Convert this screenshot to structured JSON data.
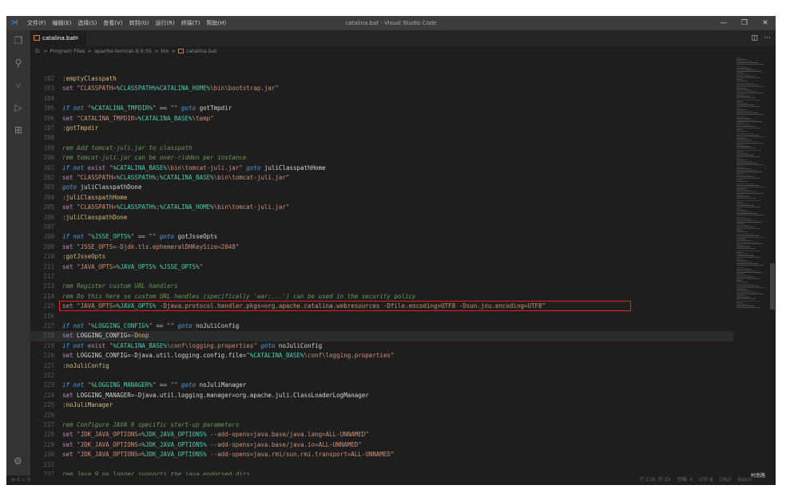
{
  "window": {
    "title": "catalina.bat - Visual Studio Code",
    "menu": [
      "文件(F)",
      "编辑(E)",
      "选择(S)",
      "查看(V)",
      "转到(G)",
      "运行(R)",
      "终端(T)",
      "帮助(H)"
    ],
    "controls": [
      "—",
      "❐",
      "✕"
    ]
  },
  "tab": {
    "label": "catalina.bat",
    "close": "✕"
  },
  "tab_actions": [
    "◫",
    "···"
  ],
  "breadcrumb": [
    "D:",
    ">",
    "Program Files",
    ">",
    "apache-tomcat-9.0.55",
    ">",
    "bin",
    ">",
    "catalina.bat"
  ],
  "editor": {
    "lines": [
      {
        "n": "192",
        "html": "<span class=\"lbl2\">:emptyClasspath</span>"
      },
      {
        "n": "193",
        "html": "<span class=\"cmd\">set</span> <span class=\"str\">\"CLASSPATH=<span class=\"var\">%CLASSPATH%</span><span class=\"var\">%CATALINA_HOME%</span>\\bin\\bootstrap.jar\"</span>"
      },
      {
        "n": "194",
        "html": ""
      },
      {
        "n": "195",
        "html": "<span class=\"kw\">if</span> <span class=\"kw\">not</span> <span class=\"str\">\"<span class=\"var\">%CATALINA_TMPDIR%</span>\"</span> == <span class=\"str\">\"\"</span> <span class=\"kw\">goto</span> gotTmpdir"
      },
      {
        "n": "196",
        "html": "<span class=\"cmd\">set</span> <span class=\"str\">\"CATALINA_TMPDIR=<span class=\"var\">%CATALINA_BASE%</span>\\temp\"</span>"
      },
      {
        "n": "197",
        "html": "<span class=\"lbl2\">:gotTmpdir</span>"
      },
      {
        "n": "198",
        "html": ""
      },
      {
        "n": "199",
        "html": "<span class=\"cm\">rem Add tomcat-juli.jar to classpath</span>"
      },
      {
        "n": "200",
        "html": "<span class=\"cm\">rem tomcat-juli.jar can be over-ridden per instance</span>"
      },
      {
        "n": "201",
        "html": "<span class=\"kw\">if</span> <span class=\"kw\">not</span> <span class=\"cmd\">exist</span> <span class=\"str\">\"<span class=\"var\">%CATALINA_BASE%</span>\\bin\\tomcat-juli.jar\"</span> <span class=\"kw\">goto</span> juliClasspathHome"
      },
      {
        "n": "202",
        "html": "<span class=\"cmd\">set</span> <span class=\"str\">\"CLASSPATH=<span class=\"var\">%CLASSPATH%</span>;<span class=\"var\">%CATALINA_BASE%</span>\\bin\\tomcat-juli.jar\"</span>"
      },
      {
        "n": "203",
        "html": "<span class=\"kw\">goto</span> juliClasspathDone"
      },
      {
        "n": "204",
        "html": "<span class=\"lbl2\">:juliClasspathHome</span>"
      },
      {
        "n": "205",
        "html": "<span class=\"cmd\">set</span> <span class=\"str\">\"CLASSPATH=<span class=\"var\">%CLASSPATH%</span>;<span class=\"var\">%CATALINA_HOME%</span>\\bin\\tomcat-juli.jar\"</span>"
      },
      {
        "n": "206",
        "html": "<span class=\"lbl2\">:juliClasspathDone</span>"
      },
      {
        "n": "207",
        "html": ""
      },
      {
        "n": "208",
        "html": "<span class=\"kw\">if</span> <span class=\"kw\">not</span> <span class=\"str\">\"<span class=\"var\">%JSSE_OPTS%</span>\"</span> == <span class=\"str\">\"\"</span> <span class=\"kw\">goto</span> gotJsseOpts"
      },
      {
        "n": "209",
        "html": "<span class=\"cmd\">set</span> <span class=\"str\">\"JSSE_OPTS=-Djdk.tls.ephemeralDHKeySize=2048\"</span>"
      },
      {
        "n": "210",
        "html": "<span class=\"lbl2\">:gotJsseOpts</span>"
      },
      {
        "n": "211",
        "html": "<span class=\"cmd\">set</span> <span class=\"str\">\"JAVA_OPTS=<span class=\"var\">%JAVA_OPTS%</span> <span class=\"var\">%JSSE_OPTS%</span>\"</span>"
      },
      {
        "n": "212",
        "html": ""
      },
      {
        "n": "213",
        "html": "<span class=\"cm\">rem Register custom URL handlers</span>"
      },
      {
        "n": "214",
        "html": "<span class=\"cm\">rem Do this here so custom URL handles (specifically 'war:...') can be used in the security policy</span>"
      },
      {
        "n": "215",
        "html": "<span class=\"cmd\">set</span> <span class=\"str\">\"JAVA_OPTS=<span class=\"var\">%JAVA_OPTS%</span> -Djava.protocol.handler.pkgs=org.apache.catalina.webresources -Dfile.encoding=UTF8 -Dsun.jnu.encoding=UTF8\"</span>",
        "boxed": true
      },
      {
        "n": "216",
        "html": ""
      },
      {
        "n": "217",
        "html": "<span class=\"kw\">if</span> <span class=\"kw\">not</span> <span class=\"str\">\"<span class=\"var\">%LOGGING_CONFIG%</span>\"</span> == <span class=\"str\">\"\"</span> <span class=\"kw\">goto</span> noJuliConfig"
      },
      {
        "n": "218",
        "html": "<span class=\"cmd\">set</span> LOGGING_CONFIG=-<span class=\"lbl2\">Dnop</span>",
        "current": true
      },
      {
        "n": "219",
        "html": "<span class=\"kw\">if</span> <span class=\"kw\">not</span> <span class=\"cmd\">exist</span> <span class=\"str\">\"<span class=\"var\">%CATALINA_BASE%</span>\\conf\\logging.properties\"</span> <span class=\"kw\">goto</span> noJuliConfig"
      },
      {
        "n": "220",
        "html": "<span class=\"cmd\">set</span> LOGGING_CONFIG=-Djava.util.logging.config.file=<span class=\"str\">\"<span class=\"var\">%CATALINA_BASE%</span>\\conf\\logging.properties\"</span>"
      },
      {
        "n": "221",
        "html": "<span class=\"lbl2\">:noJuliConfig</span>"
      },
      {
        "n": "222",
        "html": ""
      },
      {
        "n": "223",
        "html": "<span class=\"kw\">if</span> <span class=\"kw\">not</span> <span class=\"str\">\"<span class=\"var\">%LOGGING_MANAGER%</span>\"</span> == <span class=\"str\">\"\"</span> <span class=\"kw\">goto</span> noJuliManager"
      },
      {
        "n": "224",
        "html": "<span class=\"cmd\">set</span> LOGGING_MANAGER=-Djava.util.logging.manager=org.apache.juli.ClassLoaderLogManager"
      },
      {
        "n": "225",
        "html": "<span class=\"lbl2\">:noJuliManager</span>"
      },
      {
        "n": "226",
        "html": ""
      },
      {
        "n": "227",
        "html": "<span class=\"cm\">rem Configure JAVA 9 specific start-up parameters</span>"
      },
      {
        "n": "228",
        "html": "<span class=\"cmd\">set</span> <span class=\"str\">\"JDK_JAVA_OPTIONS=<span class=\"var\">%JDK_JAVA_OPTIONS%</span> --add-opens=java.base/java.lang=ALL-UNNAMED\"</span>"
      },
      {
        "n": "229",
        "html": "<span class=\"cmd\">set</span> <span class=\"str\">\"JDK_JAVA_OPTIONS=<span class=\"var\">%JDK_JAVA_OPTIONS%</span> --add-opens=java.base/java.io=ALL-UNNAMED\"</span>"
      },
      {
        "n": "230",
        "html": "<span class=\"cmd\">set</span> <span class=\"str\">\"JDK_JAVA_OPTIONS=<span class=\"var\">%JDK_JAVA_OPTIONS%</span> --add-opens=java.rmi/sun.rmi.transport=ALL-UNNAMED\"</span>"
      },
      {
        "n": "231",
        "html": ""
      },
      {
        "n": "232",
        "html": "<span class=\"cm\">rem Java 9 no longer supports the java.endorsed.dirs</span>"
      },
      {
        "n": "233",
        "html": "<span class=\"cm\">rem system property. Only try to use it if</span>"
      }
    ]
  },
  "status": {
    "left": "⊗ 0 ⚠ 0",
    "right": [
      "行 218, 列 25",
      "空格: 4",
      "UTF-8",
      "CRLF",
      "Batch"
    ]
  },
  "watermark": "村南路"
}
